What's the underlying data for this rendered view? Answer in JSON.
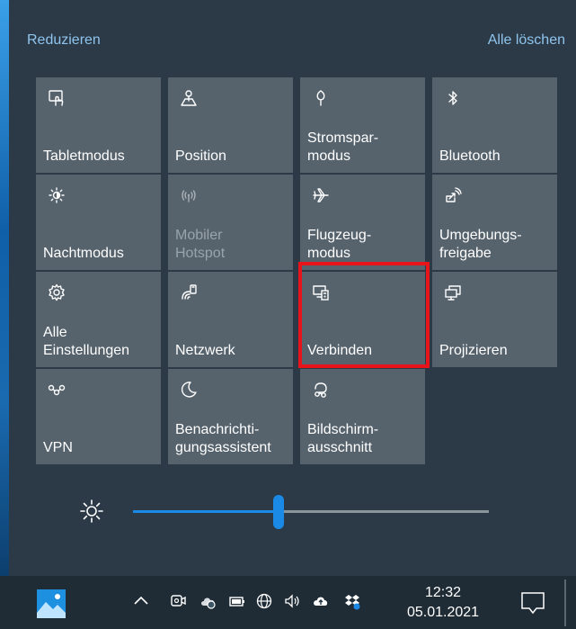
{
  "header": {
    "collapse_label": "Reduzieren",
    "clear_all_label": "Alle löschen"
  },
  "tiles": [
    {
      "label": "Tabletmodus",
      "icon": "tablet-mode-icon",
      "enabled": true
    },
    {
      "label": "Position",
      "icon": "location-icon",
      "enabled": true
    },
    {
      "label": "Stromspar-\nmodus",
      "icon": "battery-saver-icon",
      "enabled": true
    },
    {
      "label": "Bluetooth",
      "icon": "bluetooth-icon",
      "enabled": true
    },
    {
      "label": "Nachtmodus",
      "icon": "night-light-icon",
      "enabled": true
    },
    {
      "label": "Mobiler\nHotspot",
      "icon": "mobile-hotspot-icon",
      "enabled": false
    },
    {
      "label": "Flugzeug-\nmodus",
      "icon": "airplane-icon",
      "enabled": true
    },
    {
      "label": "Umgebungs-\nfreigabe",
      "icon": "nearby-sharing-icon",
      "enabled": true
    },
    {
      "label": "Alle\nEinstellungen",
      "icon": "gear-icon",
      "enabled": true
    },
    {
      "label": "Netzwerk",
      "icon": "network-icon",
      "enabled": true
    },
    {
      "label": "Verbinden",
      "icon": "connect-icon",
      "enabled": true
    },
    {
      "label": "Projizieren",
      "icon": "project-icon",
      "enabled": true
    },
    {
      "label": "VPN",
      "icon": "vpn-icon",
      "enabled": true
    },
    {
      "label": "Benachrichti-\ngungsassistent",
      "icon": "focus-assist-icon",
      "enabled": true
    },
    {
      "label": "Bildschirm-\nausschnitt",
      "icon": "snip-icon",
      "enabled": true
    }
  ],
  "brightness": {
    "icon": "brightness-icon",
    "level": 0.41
  },
  "taskbar": {
    "time": "12:32",
    "date": "05.01.2021",
    "tray_icons": [
      "chevron-up-icon",
      "meet-now-icon",
      "onedrive-icon",
      "battery-icon",
      "network-globe-icon",
      "volume-icon",
      "cloud-upload-icon",
      "dropbox-icon"
    ]
  },
  "colors": {
    "tile": "#56636d",
    "accent": "#1a8ae6",
    "highlight": "#e8141b",
    "link": "#8fc4ee"
  }
}
